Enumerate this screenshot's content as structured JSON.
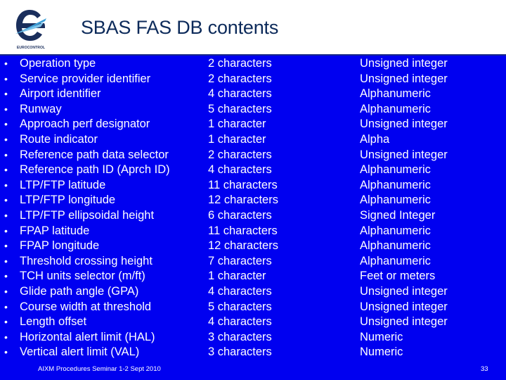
{
  "slide": {
    "title": "SBAS FAS DB contents",
    "logo_text": "EUROCONTROL",
    "footer": "AIXM Procedures Seminar 1-2 Sept 2010",
    "page_number": "33",
    "colors": {
      "background": "#0000f0",
      "title": "#0c2a5a",
      "text": "#ffffff",
      "logo_dark": "#1a2e5c",
      "logo_light": "#3a9fd8"
    }
  },
  "bullet_glyph": "•",
  "fields": [
    {
      "name": "Operation type",
      "size": "2 characters",
      "type": "Unsigned integer"
    },
    {
      "name": "Service provider identifier",
      "size": "2 characters",
      "type": "Unsigned integer"
    },
    {
      "name": "Airport identifier",
      "size": "4 characters",
      "type": "Alphanumeric"
    },
    {
      "name": "Runway",
      "size": "5 characters",
      "type": "Alphanumeric"
    },
    {
      "name": "Approach perf designator",
      "size": "1 character",
      "type": "Unsigned integer"
    },
    {
      "name": "Route indicator",
      "size": "1 character",
      "type": "Alpha"
    },
    {
      "name": "Reference path data selector",
      "size": "2 characters",
      "type": "Unsigned integer"
    },
    {
      "name": "Reference path ID (Aprch ID)",
      "size": "4 characters",
      "type": "Alphanumeric"
    },
    {
      "name": "LTP/FTP latitude",
      "size": "11 characters",
      "type": "Alphanumeric"
    },
    {
      "name": "LTP/FTP longitude",
      "size": "12 characters",
      "type": "Alphanumeric"
    },
    {
      "name": "LTP/FTP ellipsoidal height",
      "size": "6 characters",
      "type": "Signed Integer"
    },
    {
      "name": "FPAP latitude",
      "size": "11 characters",
      "type": "Alphanumeric"
    },
    {
      "name": "FPAP longitude",
      "size": "12 characters",
      "type": "Alphanumeric"
    },
    {
      "name": "Threshold crossing height",
      "size": "7 characters",
      "type": "Alphanumeric"
    },
    {
      "name": "TCH units selector (m/ft)",
      "size": "1 character",
      "type": "Feet or meters"
    },
    {
      "name": "Glide path angle (GPA)",
      "size": "4 characters",
      "type": "Unsigned integer"
    },
    {
      "name": "Course width at threshold",
      "size": "5 characters",
      "type": "Unsigned integer"
    },
    {
      "name": "Length offset",
      "size": "4 characters",
      "type": "Unsigned integer"
    },
    {
      "name": "Horizontal alert limit (HAL)",
      "size": "3 characters",
      "type": "Numeric"
    },
    {
      "name": "Vertical alert limit (VAL)",
      "size": "3 characters",
      "type": "Numeric"
    }
  ]
}
